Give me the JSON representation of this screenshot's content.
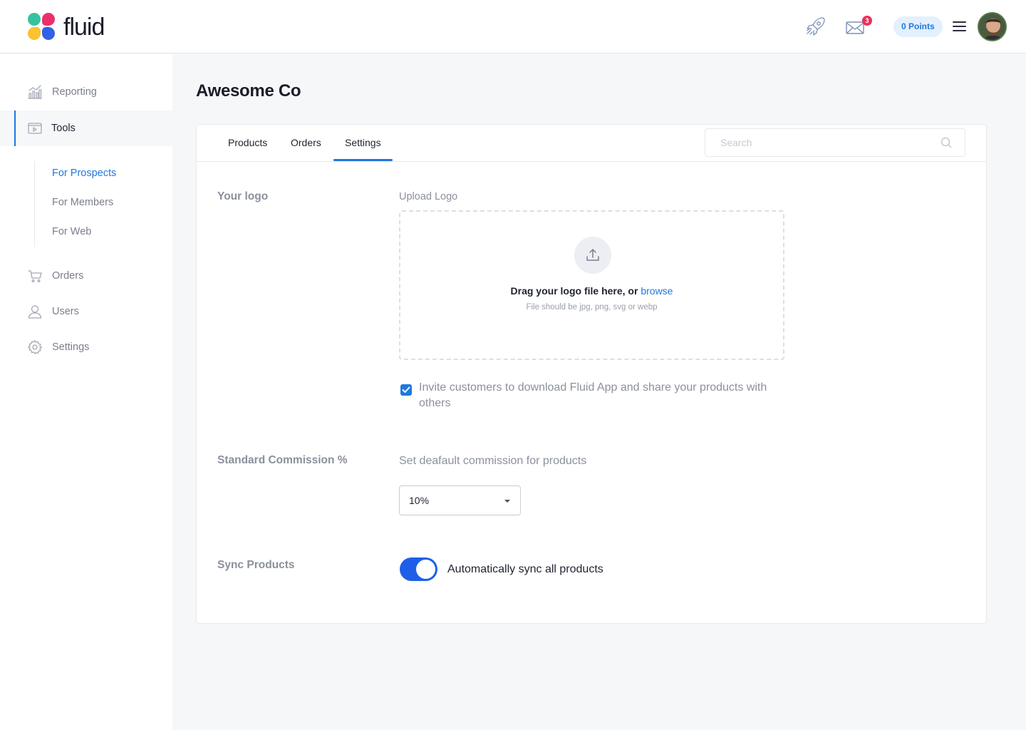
{
  "brand": {
    "name": "fluid"
  },
  "header": {
    "notifications_count": "3",
    "points_label": "0 Points"
  },
  "sidebar": {
    "items": [
      {
        "label": "Reporting",
        "icon": "chart-icon"
      },
      {
        "label": "Tools",
        "icon": "tools-icon",
        "active": true
      },
      {
        "label": "Orders",
        "icon": "cart-icon"
      },
      {
        "label": "Users",
        "icon": "user-icon"
      },
      {
        "label": "Settings",
        "icon": "gear-icon"
      }
    ],
    "subitems": [
      {
        "label": "For Prospects",
        "active": true
      },
      {
        "label": "For Members"
      },
      {
        "label": "For Web"
      }
    ]
  },
  "main": {
    "title": "Awesome Co",
    "tabs": [
      {
        "label": "Products"
      },
      {
        "label": "Orders"
      },
      {
        "label": "Settings",
        "active": true
      }
    ],
    "search": {
      "placeholder": "Search",
      "value": ""
    },
    "logo_section": {
      "label": "Your logo",
      "upload_label": "Upload Logo",
      "drop_text": "Drag your logo file here, or",
      "browse_label": "browse",
      "hint": "File should be jpg, png, svg or webp",
      "invite_checked": true,
      "invite_label": "Invite customers to download Fluid App and share your products with others"
    },
    "commission_section": {
      "label": "Standard Commission %",
      "description": "Set deafault commission for products",
      "selected": "10%"
    },
    "sync_section": {
      "label": "Sync Products",
      "toggle_on": true,
      "toggle_label": "Automatically sync all products"
    }
  },
  "colors": {
    "accent": "#1f78e0",
    "toggle": "#1f5fe8",
    "badge": "#ec2f5a",
    "logo": [
      "#34c3a0",
      "#ec2f6b",
      "#fcc22f",
      "#3161e8"
    ]
  }
}
